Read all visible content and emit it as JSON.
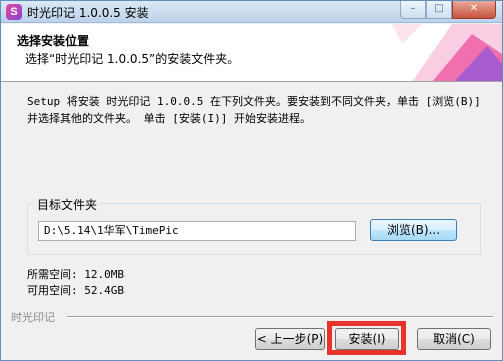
{
  "window": {
    "title": "时光印记 1.0.0.5 安装",
    "app_icon": "S",
    "buttons": [
      "minimize-icon",
      "maximize-icon",
      "close-icon"
    ],
    "minimize_glyph": "–",
    "maximize_glyph": "□",
    "close_glyph": "✕"
  },
  "header": {
    "title": "选择安装位置",
    "subtitle": "选择“时光印记 1.0.0.5”的安装文件夹。"
  },
  "body": {
    "description": "Setup 将安装 时光印记 1.0.0.5 在下列文件夹。要安装到不同文件夹，单击 [浏览(B)] 并选择其他的文件夹。 单击 [安装(I)] 开始安装进程。",
    "target_group_label": "目标文件夹",
    "target_path": "D:\\5.14\\1华军\\TimePic",
    "browse_label": "浏览(B)...",
    "space_required": "所需空间: 12.0MB",
    "space_available": "可用空间: 52.4GB"
  },
  "footer": {
    "brand": "时光印记",
    "back_label": "< 上一步(P)",
    "install_label": "安装(I)",
    "cancel_label": "取消(C)"
  },
  "colors": {
    "highlight": "#e8332d",
    "header_art_pink": "#f06fae",
    "header_art_purple": "#9b59d6"
  }
}
